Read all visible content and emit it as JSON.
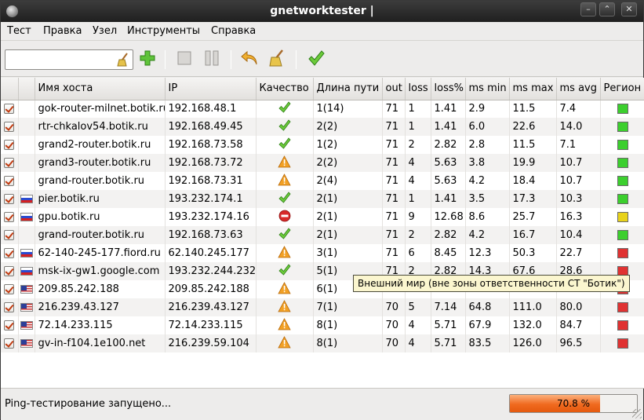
{
  "window": {
    "title": "gnetworktester |"
  },
  "menu": [
    "Тест",
    "Правка",
    "Узел",
    "Инструменты",
    "Справка"
  ],
  "toolbar": {
    "search_value": ""
  },
  "columns": [
    "",
    "",
    "Имя хоста",
    "IP",
    "Качество",
    "Длина пути",
    "out",
    "loss",
    "loss%",
    "ms min",
    "ms max",
    "ms avg",
    "Регион"
  ],
  "rows": [
    {
      "checked": true,
      "flag": "",
      "host": "gok-router-milnet.botik.ru",
      "ip": "192.168.48.1",
      "quality": "ok",
      "path": "1(14)",
      "out": "71",
      "loss": "1",
      "loss_pct": "1.41",
      "ms_min": "2.9",
      "ms_max": "11.5",
      "ms_avg": "7.4",
      "region": "#3ccf2e"
    },
    {
      "checked": true,
      "flag": "",
      "host": "rtr-chkalov54.botik.ru",
      "ip": "192.168.49.45",
      "quality": "ok",
      "path": "2(2)",
      "out": "71",
      "loss": "1",
      "loss_pct": "1.41",
      "ms_min": "6.0",
      "ms_max": "22.6",
      "ms_avg": "14.0",
      "region": "#3ccf2e"
    },
    {
      "checked": true,
      "flag": "",
      "host": "grand2-router.botik.ru",
      "ip": "192.168.73.58",
      "quality": "ok",
      "path": "1(2)",
      "out": "71",
      "loss": "2",
      "loss_pct": "2.82",
      "ms_min": "2.8",
      "ms_max": "11.5",
      "ms_avg": "7.1",
      "region": "#3ccf2e"
    },
    {
      "checked": true,
      "flag": "",
      "host": "grand3-router.botik.ru",
      "ip": "192.168.73.72",
      "quality": "warn",
      "path": "2(2)",
      "out": "71",
      "loss": "4",
      "loss_pct": "5.63",
      "ms_min": "3.8",
      "ms_max": "19.9",
      "ms_avg": "10.7",
      "region": "#3ccf2e"
    },
    {
      "checked": true,
      "flag": "",
      "host": "grand-router.botik.ru",
      "ip": "192.168.73.31",
      "quality": "warn",
      "path": "2(4)",
      "out": "71",
      "loss": "4",
      "loss_pct": "5.63",
      "ms_min": "4.2",
      "ms_max": "18.4",
      "ms_avg": "10.7",
      "region": "#3ccf2e"
    },
    {
      "checked": true,
      "flag": "ru",
      "host": "pier.botik.ru",
      "ip": "193.232.174.1",
      "quality": "ok",
      "path": "2(1)",
      "out": "71",
      "loss": "1",
      "loss_pct": "1.41",
      "ms_min": "3.5",
      "ms_max": "17.3",
      "ms_avg": "10.3",
      "region": "#3ccf2e"
    },
    {
      "checked": true,
      "flag": "ru",
      "host": "gpu.botik.ru",
      "ip": "193.232.174.16",
      "quality": "stop",
      "path": "2(1)",
      "out": "71",
      "loss": "9",
      "loss_pct": "12.68",
      "ms_min": "8.6",
      "ms_max": "25.7",
      "ms_avg": "16.3",
      "region": "#e8d21a"
    },
    {
      "checked": true,
      "flag": "",
      "host": "grand-router.botik.ru",
      "ip": "192.168.73.63",
      "quality": "ok",
      "path": "2(1)",
      "out": "71",
      "loss": "2",
      "loss_pct": "2.82",
      "ms_min": "4.2",
      "ms_max": "16.7",
      "ms_avg": "10.4",
      "region": "#3ccf2e"
    },
    {
      "checked": true,
      "flag": "ru",
      "host": "62-140-245-177.fiord.ru",
      "ip": "62.140.245.177",
      "quality": "warn",
      "path": "3(1)",
      "out": "71",
      "loss": "6",
      "loss_pct": "8.45",
      "ms_min": "12.3",
      "ms_max": "50.3",
      "ms_avg": "22.7",
      "region": "#e03232"
    },
    {
      "checked": true,
      "flag": "ru",
      "host": "msk-ix-gw1.google.com",
      "ip": "193.232.244.232",
      "quality": "ok",
      "path": "5(1)",
      "out": "71",
      "loss": "2",
      "loss_pct": "2.82",
      "ms_min": "14.3",
      "ms_max": "67.6",
      "ms_avg": "28.6",
      "region": "#e03232"
    },
    {
      "checked": true,
      "flag": "us",
      "host": "209.85.242.188",
      "ip": "209.85.242.188",
      "quality": "warn",
      "path": "6(1)",
      "out": "",
      "loss": "",
      "loss_pct": "",
      "ms_min": "",
      "ms_max": "",
      "ms_avg": "",
      "region": "#e03232"
    },
    {
      "checked": true,
      "flag": "us",
      "host": "216.239.43.127",
      "ip": "216.239.43.127",
      "quality": "warn",
      "path": "7(1)",
      "out": "70",
      "loss": "5",
      "loss_pct": "7.14",
      "ms_min": "64.8",
      "ms_max": "111.0",
      "ms_avg": "80.0",
      "region": "#e03232"
    },
    {
      "checked": true,
      "flag": "us",
      "host": "72.14.233.115",
      "ip": "72.14.233.115",
      "quality": "warn",
      "path": "8(1)",
      "out": "70",
      "loss": "4",
      "loss_pct": "5.71",
      "ms_min": "67.9",
      "ms_max": "132.0",
      "ms_avg": "84.7",
      "region": "#e03232"
    },
    {
      "checked": true,
      "flag": "us",
      "host": "gv-in-f104.1e100.net",
      "ip": "216.239.59.104",
      "quality": "warn",
      "path": "8(1)",
      "out": "70",
      "loss": "4",
      "loss_pct": "5.71",
      "ms_min": "83.5",
      "ms_max": "126.0",
      "ms_avg": "96.5",
      "region": "#e03232"
    }
  ],
  "tooltip": "Внешний мир (вне зоны ответственности СТ \"Ботик\")",
  "status": {
    "text": "Ping-тестирование запущено...",
    "progress_label": "70.8 %",
    "progress": 70.8
  }
}
